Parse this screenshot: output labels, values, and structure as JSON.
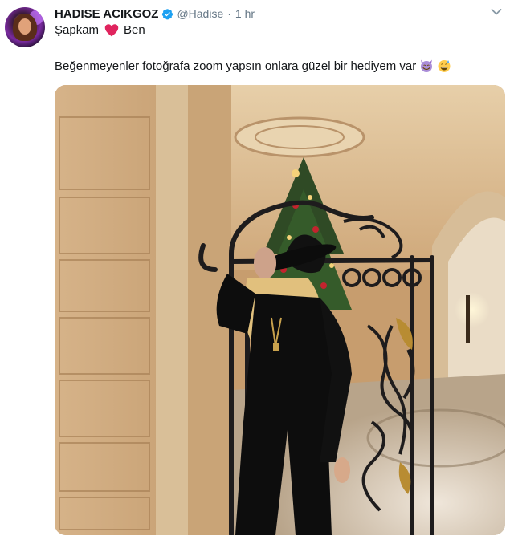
{
  "tweet": {
    "author_name": "HADISE ACIKGOZ",
    "handle": "@Hadise",
    "separator": "·",
    "time": "1 hr",
    "line1_left": "Şapkam",
    "line1_right": "Ben",
    "text": "Beğenmeyenler fotoğrafa zoom yapsın onlara güzel bir hediyem var"
  },
  "icons": {
    "verified": "verified-badge-icon",
    "heart": "red-heart-icon",
    "menu": "chevron-down-icon",
    "emoji1": "smiling-devil-emoji",
    "emoji2": "grinning-sweat-emoji"
  },
  "colors": {
    "verified_blue": "#1da1f2",
    "heart_red": "#e0245e",
    "muted_text": "#657786"
  }
}
